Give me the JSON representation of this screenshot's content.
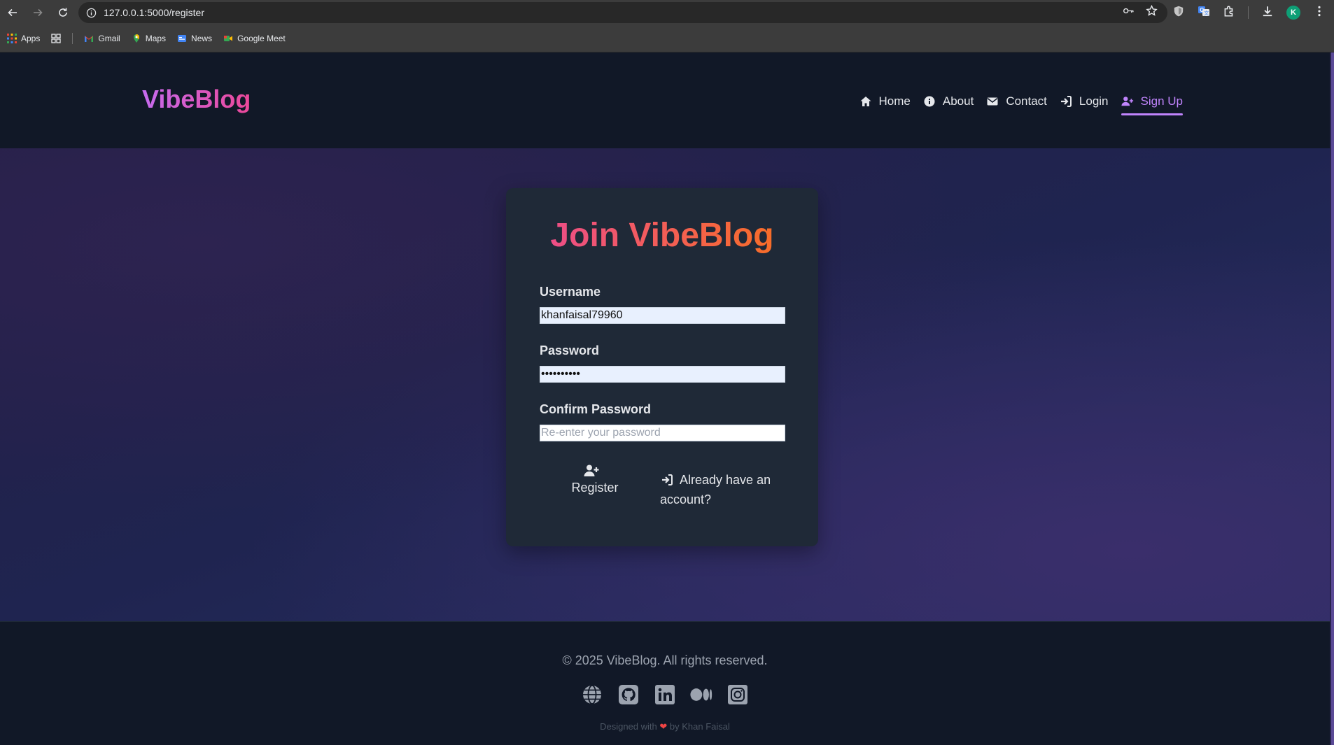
{
  "browser": {
    "url": "127.0.0.1:5000/register",
    "profile_initial": "K",
    "bookmarks": [
      "Apps",
      "Gmail",
      "Maps",
      "News",
      "Google Meet"
    ]
  },
  "header": {
    "brand": "VibeBlog",
    "nav": {
      "home": "Home",
      "about": "About",
      "contact": "Contact",
      "login": "Login",
      "signup": "Sign Up"
    },
    "active_item": "signup"
  },
  "form": {
    "title": "Join VibeBlog",
    "username_label": "Username",
    "username_value": "khanfaisal79960",
    "password_label": "Password",
    "password_value": "••••••••••",
    "confirm_label": "Confirm Password",
    "confirm_placeholder": "Re-enter your password",
    "register_label": "Register",
    "login_link": "Already have an account?"
  },
  "footer": {
    "copyright": "© 2025 VibeBlog. All rights reserved.",
    "designed_prefix": "Designed with",
    "designed_suffix": "by Khan Faisal",
    "social_icons": [
      "globe-icon",
      "github-icon",
      "linkedin-icon",
      "medium-icon",
      "instagram-icon"
    ]
  },
  "colors": {
    "brand_gradient_start": "#c66bef",
    "brand_gradient_end": "#ec4899",
    "title_gradient_start": "#ec4899",
    "title_gradient_end": "#f97316",
    "active_nav": "#c084fc",
    "header_bg": "#111827",
    "card_bg": "#1f2937"
  }
}
